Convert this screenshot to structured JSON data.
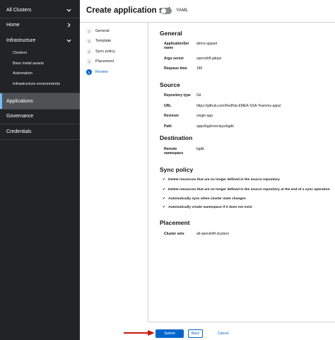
{
  "sidebar": {
    "cluster_switcher": "All Clusters",
    "home": "Home",
    "infrastructure": "Infrastructure",
    "infra_items": [
      "Clusters",
      "Bare metal assets",
      "Automation",
      "Infrastructure environments"
    ],
    "applications": "Applications",
    "governance": "Governance",
    "credentials": "Credentials"
  },
  "header": {
    "title": "Create application set",
    "yaml_label": "YAML"
  },
  "wizard": {
    "steps": [
      {
        "num": "1",
        "label": "General"
      },
      {
        "num": "2",
        "label": "Template"
      },
      {
        "num": "3",
        "label": "Sync policy"
      },
      {
        "num": "4",
        "label": "Placement"
      },
      {
        "num": "5",
        "label": "Review"
      }
    ]
  },
  "review": {
    "general": {
      "title": "General",
      "appset_name_label": "ApplicationSet name",
      "appset_name": "demo-appset",
      "argo_server_label": "Argo server",
      "argo_server": "openshift-gitops",
      "requeue_time_label": "Requeue time",
      "requeue_time": "180"
    },
    "source": {
      "title": "Source",
      "repo_type_label": "Repository type",
      "repo_type": "Git",
      "url_label": "URL",
      "url": "https://github.com/RedHat-EMEA-SSA-Team/ns-apps/",
      "revision_label": "Revision",
      "revision": "single-app",
      "path_label": "Path",
      "path": "apps/bgd/overlays/bgdk"
    },
    "destination": {
      "title": "Destination",
      "remote_ns_label": "Remote namespace",
      "remote_ns": "bgdk"
    },
    "sync_policy": {
      "title": "Sync policy",
      "items": [
        "Delete resources that are no longer defined in the source repository",
        "Delete resources that are no longer defined in the source repository at the end of a sync operation",
        "Automatically sync when cluster state changes",
        "Automatically create namespace if it does not exist"
      ]
    },
    "placement": {
      "title": "Placement",
      "cluster_sets_label": "Cluster sets",
      "cluster_sets": "all-openshift-clusters"
    }
  },
  "footer": {
    "submit": "Submit",
    "back": "Back",
    "cancel": "Cancel"
  },
  "colors": {
    "sidebar_bg": "#212427",
    "sidebar_active": "#4f5255",
    "primary": "#0066cc",
    "arrow": "#c9190b"
  }
}
